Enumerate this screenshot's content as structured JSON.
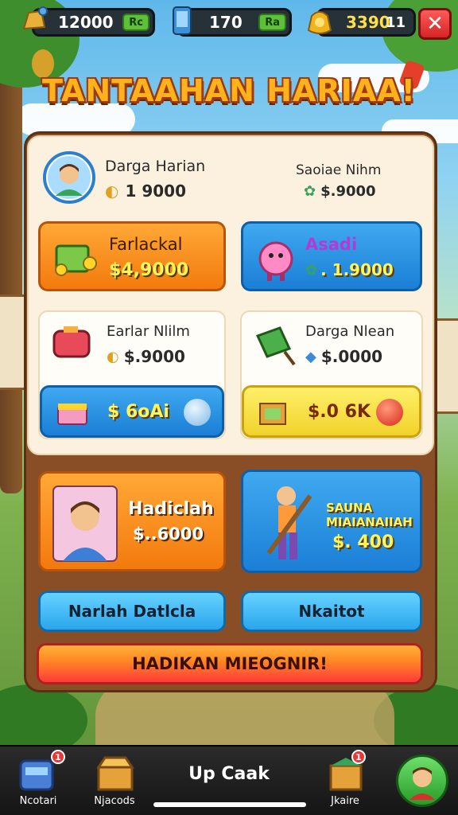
{
  "hud": {
    "coins": "12000",
    "coins_add": "Rc",
    "gems": "170",
    "gems_add": "Ra",
    "gold": "3390",
    "gold_extra": "11",
    "close_label": "✕"
  },
  "title": "TANTAAHAN HARIAA!",
  "profile": {
    "name": "Darga Harian",
    "value": "1 9000",
    "right_label": "Saoiae Nihm",
    "right_value": "$.9000"
  },
  "offers_row1": [
    {
      "title": "Farlackal",
      "price": "$4,9000",
      "color": "orange"
    },
    {
      "title": "Asadi",
      "price": ". 1.9000",
      "color": "blue"
    }
  ],
  "offers_row2": [
    {
      "title": "Earlar Nlilm",
      "price": "$.9000",
      "button": "$ 6oAi"
    },
    {
      "title": "Darga Nlean",
      "price": "$.0000",
      "button": "$.0 6K"
    }
  ],
  "bundles": [
    {
      "title": "Hadiclah",
      "price": "$..6000"
    },
    {
      "title": "SAUNA MIAIANAIIAH",
      "price": "$. 400"
    }
  ],
  "buttons": {
    "left": "Narlah Datlcla",
    "right": "Nkaitot",
    "wide": "HADIKAN MIEOGNIR!"
  },
  "bottom_nav": {
    "item1": "Ncotari",
    "item2": "Njacods",
    "center": "Up Caak",
    "item4": "Jkaire",
    "badge1": "1",
    "badge4": "1"
  },
  "colors": {
    "orange": "#f37a0d",
    "blue": "#1b7fd6",
    "yellow": "#f1d22a",
    "red": "#e53935",
    "gold_title": "#ffb21c"
  }
}
